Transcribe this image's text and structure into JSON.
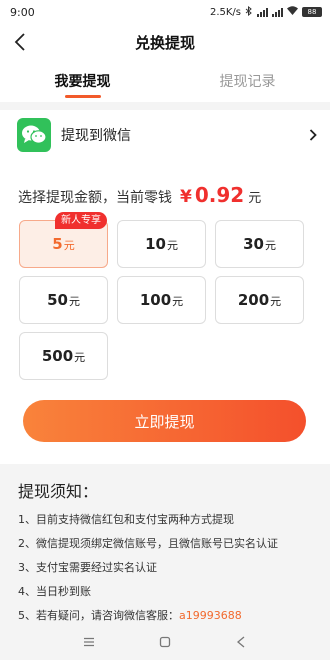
{
  "status_bar": {
    "time": "9:00",
    "speed": "2.5K/s",
    "battery": "88"
  },
  "header": {
    "title": "兑换提现"
  },
  "tabs": [
    {
      "label": "我要提现"
    },
    {
      "label": "提现记录"
    }
  ],
  "method": {
    "label": "提现到微信",
    "icon": "wechat-icon"
  },
  "balance": {
    "prompt": "选择提现金额，当前零钱",
    "currency": "¥",
    "amount": "0.92",
    "unit": "元"
  },
  "amounts": [
    {
      "value": "5",
      "unit": "元",
      "badge": "新人专享"
    },
    {
      "value": "10",
      "unit": "元"
    },
    {
      "value": "30",
      "unit": "元"
    },
    {
      "value": "50",
      "unit": "元"
    },
    {
      "value": "100",
      "unit": "元"
    },
    {
      "value": "200",
      "unit": "元"
    },
    {
      "value": "500",
      "unit": "元"
    }
  ],
  "withdraw_button": {
    "label": "立即提现"
  },
  "notice": {
    "title": "提现须知：",
    "items": [
      "1、目前支持微信红包和支付宝两种方式提现",
      "2、微信提现须绑定微信账号，且微信账号已实名认证",
      "3、支付宝需要经过实名认证",
      "4、当日秒到账"
    ],
    "contact_prefix": "5、若有疑问，请咨询微信客服：",
    "contact_id": "a19993688"
  },
  "colors": {
    "accent": "#f25a2a",
    "price": "#f0302e",
    "wechat": "#31c15a"
  }
}
